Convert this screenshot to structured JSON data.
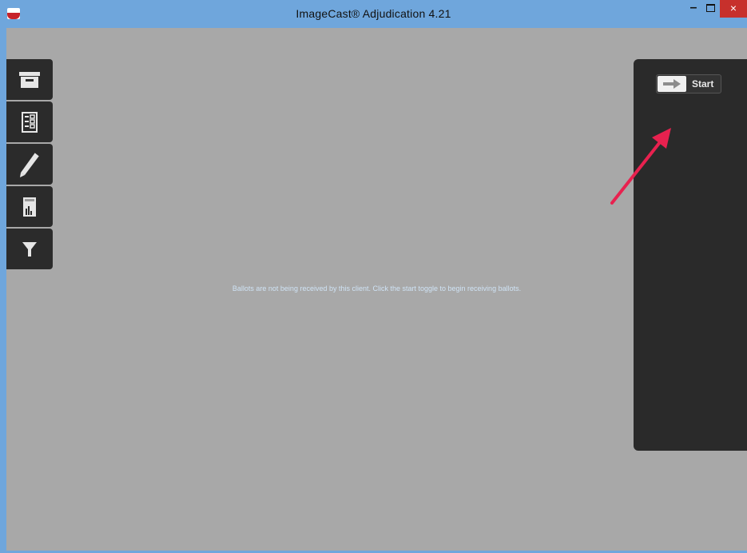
{
  "window": {
    "title": "ImageCast® Adjudication 4.21",
    "app_icon": "app-logo-icon",
    "controls": {
      "minimize": "–",
      "maximize": "maximize-icon",
      "close": "×"
    },
    "accent_color": "#6fa6dc",
    "close_color": "#c7302c"
  },
  "toolbar": {
    "items": [
      {
        "name": "archive-box-icon"
      },
      {
        "name": "checklist-icon"
      },
      {
        "name": "pencil-icon"
      },
      {
        "name": "report-chart-icon"
      },
      {
        "name": "filter-icon"
      }
    ]
  },
  "right_panel": {
    "start_toggle": {
      "label": "Start",
      "icon": "arrow-right-icon"
    }
  },
  "main": {
    "message": "Ballots are not being received by this client. Click the start toggle to begin receiving ballots.",
    "background_color": "#a8a8a8"
  },
  "annotation": {
    "icon": "red-arrow-pointer-icon",
    "color": "#e8214f"
  }
}
